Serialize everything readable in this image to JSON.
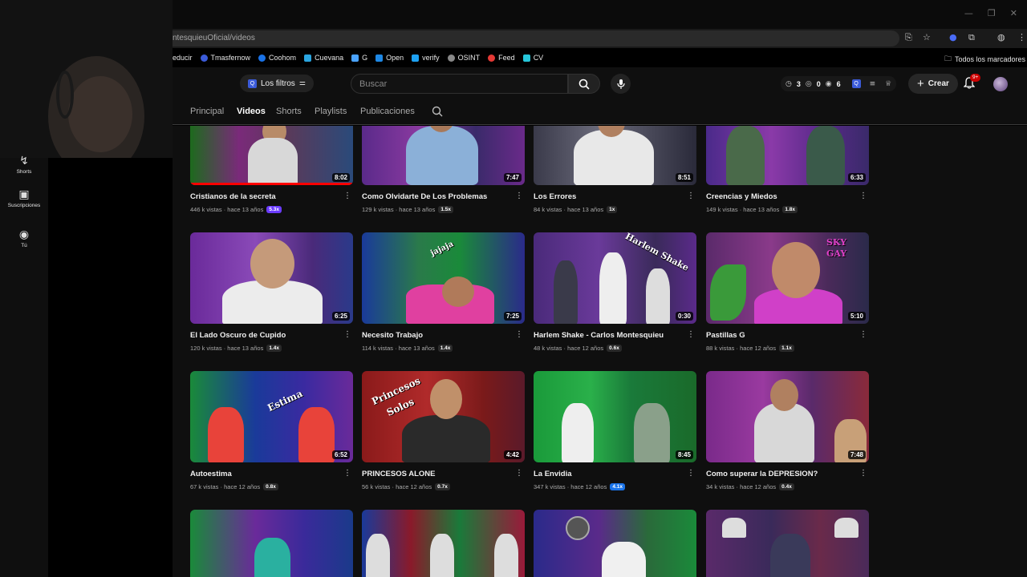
{
  "browser": {
    "url": "ntesquieuOficial/videos",
    "bookmarks": [
      "educir",
      "Tmasfernow",
      "Coohom",
      "Cuevana",
      "G",
      "Open",
      "verify",
      "OSINT",
      "Feed",
      "CV"
    ],
    "bookmarks_all": "Todos los marcadores"
  },
  "sidebar": {
    "items": [
      {
        "label": "Shorts",
        "icon": "shorts-icon"
      },
      {
        "label": "Suscripciones",
        "icon": "subscriptions-icon"
      },
      {
        "label": "Tú",
        "icon": "user-icon"
      }
    ]
  },
  "topbar": {
    "filters_label": "Los filtros",
    "search_placeholder": "Buscar",
    "ext_counts": [
      "3",
      "0",
      "6"
    ],
    "create_label": "Crear",
    "notifications_badge": "9+"
  },
  "tabs": [
    "Principal",
    "Videos",
    "Shorts",
    "Playlists",
    "Publicaciones"
  ],
  "active_tab": "Videos",
  "videos": [
    {
      "title": "Cristianos de la secreta",
      "views": "446 k vistas",
      "age": "hace 13 años",
      "mult": "5.3x",
      "mult_color": "#6b3cff",
      "duration": "8:02",
      "progress": 1.0
    },
    {
      "title": "Como Olvidarte De Los Problemas",
      "views": "129 k vistas",
      "age": "hace 13 años",
      "mult": "1.5x",
      "mult_color": "#2a2a2a",
      "duration": "7:47"
    },
    {
      "title": "Los Errores",
      "views": "84 k vistas",
      "age": "hace 13 años",
      "mult": "1x",
      "mult_color": "#2a2a2a",
      "duration": "8:51"
    },
    {
      "title": "Creencias y Miedos",
      "views": "149 k vistas",
      "age": "hace 13 años",
      "mult": "1.8x",
      "mult_color": "#2a2a2a",
      "duration": "6:33"
    },
    {
      "title": "El Lado Oscuro de Cupido",
      "views": "120 k vistas",
      "age": "hace 13 años",
      "mult": "1.4x",
      "mult_color": "#2a2a2a",
      "duration": "6:25"
    },
    {
      "title": "Necesito Trabajo",
      "views": "114 k vistas",
      "age": "hace 13 años",
      "mult": "1.4x",
      "mult_color": "#2a2a2a",
      "duration": "7:25"
    },
    {
      "title": "Harlem Shake - Carlos Montesquieu",
      "views": "48 k vistas",
      "age": "hace 12 años",
      "mult": "0.6x",
      "mult_color": "#2a2a2a",
      "duration": "0:30"
    },
    {
      "title": "Pastillas G",
      "views": "88 k vistas",
      "age": "hace 12 años",
      "mult": "1.1x",
      "mult_color": "#2a2a2a",
      "duration": "5:10"
    },
    {
      "title": "Autoestima",
      "views": "67 k vistas",
      "age": "hace 12 años",
      "mult": "0.8x",
      "mult_color": "#2a2a2a",
      "duration": "6:52"
    },
    {
      "title": "PRINCESOS ALONE",
      "views": "56 k vistas",
      "age": "hace 12 años",
      "mult": "0.7x",
      "mult_color": "#2a2a2a",
      "duration": "4:42"
    },
    {
      "title": "La Envidia",
      "views": "347 k vistas",
      "age": "hace 12 años",
      "mult": "4.1x",
      "mult_color": "#1a73e8",
      "duration": "8:45"
    },
    {
      "title": "Como superar la DEPRESION?",
      "views": "34 k vistas",
      "age": "hace 12 años",
      "mult": "0.4x",
      "mult_color": "#2a2a2a",
      "duration": "7:48"
    }
  ],
  "thumb_texts": {
    "harlem": "Harlem Shake",
    "estima": "Estima",
    "princesos": "Princesos",
    "solos": "Solos",
    "sky": "SKY",
    "gay": "GAY",
    "jajaja": "jajaja"
  }
}
